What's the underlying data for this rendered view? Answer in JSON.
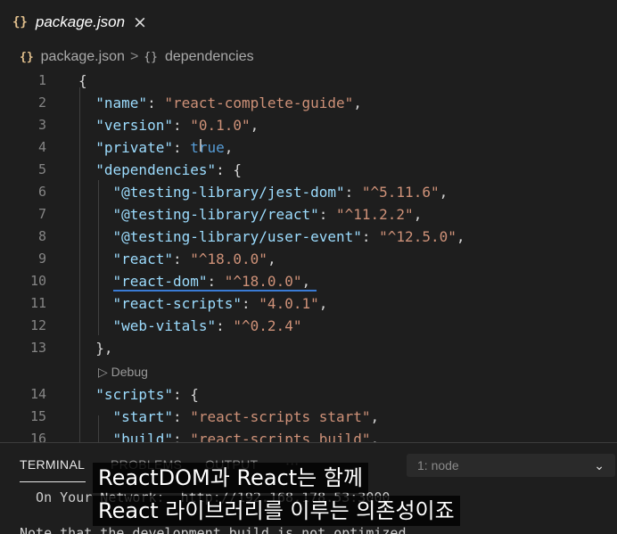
{
  "tab": {
    "icon": "braces-icon",
    "braces": "{}",
    "title": "package.json",
    "close": "×"
  },
  "breadcrumb": {
    "file": "package.json",
    "separator": ">",
    "symbol_braces": "{}",
    "symbol": "dependencies"
  },
  "editor": {
    "lines": [
      {
        "n": "1",
        "tokens": [
          [
            "p",
            "{"
          ]
        ]
      },
      {
        "n": "2",
        "tokens": [
          [
            "p",
            "  "
          ],
          [
            "k",
            "\"name\""
          ],
          [
            "p",
            ": "
          ],
          [
            "s",
            "\"react-complete-guide\""
          ],
          [
            "p",
            ","
          ]
        ]
      },
      {
        "n": "3",
        "tokens": [
          [
            "p",
            "  "
          ],
          [
            "k",
            "\"version\""
          ],
          [
            "p",
            ": "
          ],
          [
            "s",
            "\"0.1.0\""
          ],
          [
            "p",
            ","
          ]
        ]
      },
      {
        "n": "4",
        "tokens": [
          [
            "p",
            "  "
          ],
          [
            "k",
            "\"private\""
          ],
          [
            "p",
            ": "
          ],
          [
            "b",
            "true"
          ],
          [
            "p",
            ","
          ]
        ]
      },
      {
        "n": "5",
        "tokens": [
          [
            "p",
            "  "
          ],
          [
            "k",
            "\"dependencies\""
          ],
          [
            "p",
            ": {"
          ]
        ]
      },
      {
        "n": "6",
        "tokens": [
          [
            "p",
            "    "
          ],
          [
            "k",
            "\"@testing-library/jest-dom\""
          ],
          [
            "p",
            ": "
          ],
          [
            "s",
            "\"^5.11.6\""
          ],
          [
            "p",
            ","
          ]
        ]
      },
      {
        "n": "7",
        "tokens": [
          [
            "p",
            "    "
          ],
          [
            "k",
            "\"@testing-library/react\""
          ],
          [
            "p",
            ": "
          ],
          [
            "s",
            "\"^11.2.2\""
          ],
          [
            "p",
            ","
          ]
        ]
      },
      {
        "n": "8",
        "tokens": [
          [
            "p",
            "    "
          ],
          [
            "k",
            "\"@testing-library/user-event\""
          ],
          [
            "p",
            ": "
          ],
          [
            "s",
            "\"^12.5.0\""
          ],
          [
            "p",
            ","
          ]
        ]
      },
      {
        "n": "9",
        "tokens": [
          [
            "p",
            "    "
          ],
          [
            "k",
            "\"react\""
          ],
          [
            "p",
            ": "
          ],
          [
            "s",
            "\"^18.0.0\""
          ],
          [
            "p",
            ","
          ]
        ]
      },
      {
        "n": "10",
        "tokens": [
          [
            "p",
            "    "
          ],
          [
            "k",
            "\"react-dom\""
          ],
          [
            "p",
            ": "
          ],
          [
            "s",
            "\"^18.0.0\""
          ],
          [
            "p",
            ","
          ]
        ]
      },
      {
        "n": "11",
        "tokens": [
          [
            "p",
            "    "
          ],
          [
            "k",
            "\"react-scripts\""
          ],
          [
            "p",
            ": "
          ],
          [
            "s",
            "\"4.0.1\""
          ],
          [
            "p",
            ","
          ]
        ]
      },
      {
        "n": "12",
        "tokens": [
          [
            "p",
            "    "
          ],
          [
            "k",
            "\"web-vitals\""
          ],
          [
            "p",
            ": "
          ],
          [
            "s",
            "\"^0.2.4\""
          ]
        ]
      },
      {
        "n": "13",
        "tokens": [
          [
            "p",
            "  },"
          ]
        ]
      },
      {
        "n": "14",
        "tokens": [
          [
            "p",
            "  "
          ],
          [
            "k",
            "\"scripts\""
          ],
          [
            "p",
            ": {"
          ]
        ]
      },
      {
        "n": "15",
        "tokens": [
          [
            "p",
            "    "
          ],
          [
            "k",
            "\"start\""
          ],
          [
            "p",
            ": "
          ],
          [
            "s",
            "\"react-scripts start\""
          ],
          [
            "p",
            ","
          ]
        ]
      },
      {
        "n": "16",
        "tokens": [
          [
            "p",
            "    "
          ],
          [
            "k",
            "\"build\""
          ],
          [
            "p",
            ": "
          ],
          [
            "s",
            "\"react-scripts build\""
          ],
          [
            "p",
            ","
          ]
        ]
      }
    ],
    "codelens": "▷ Debug",
    "colors": {
      "key": "#9cdcfe",
      "string": "#ce9178",
      "punct": "#d4d4d4",
      "bool": "#569cd6",
      "line_number": "#858585"
    }
  },
  "panel": {
    "tabs": [
      "TERMINAL",
      "PROBLEMS",
      "OUTPUT"
    ],
    "more": "···",
    "terminal_select": "1: node",
    "terminal_lines": [
      "  On Your Network:  http://192.168.178.53:3000",
      "Note that the development build is not optimized."
    ]
  },
  "subtitles": [
    "ReactDOM과 React는 함께",
    "React 라이브러리를 이루는 의존성이죠"
  ]
}
